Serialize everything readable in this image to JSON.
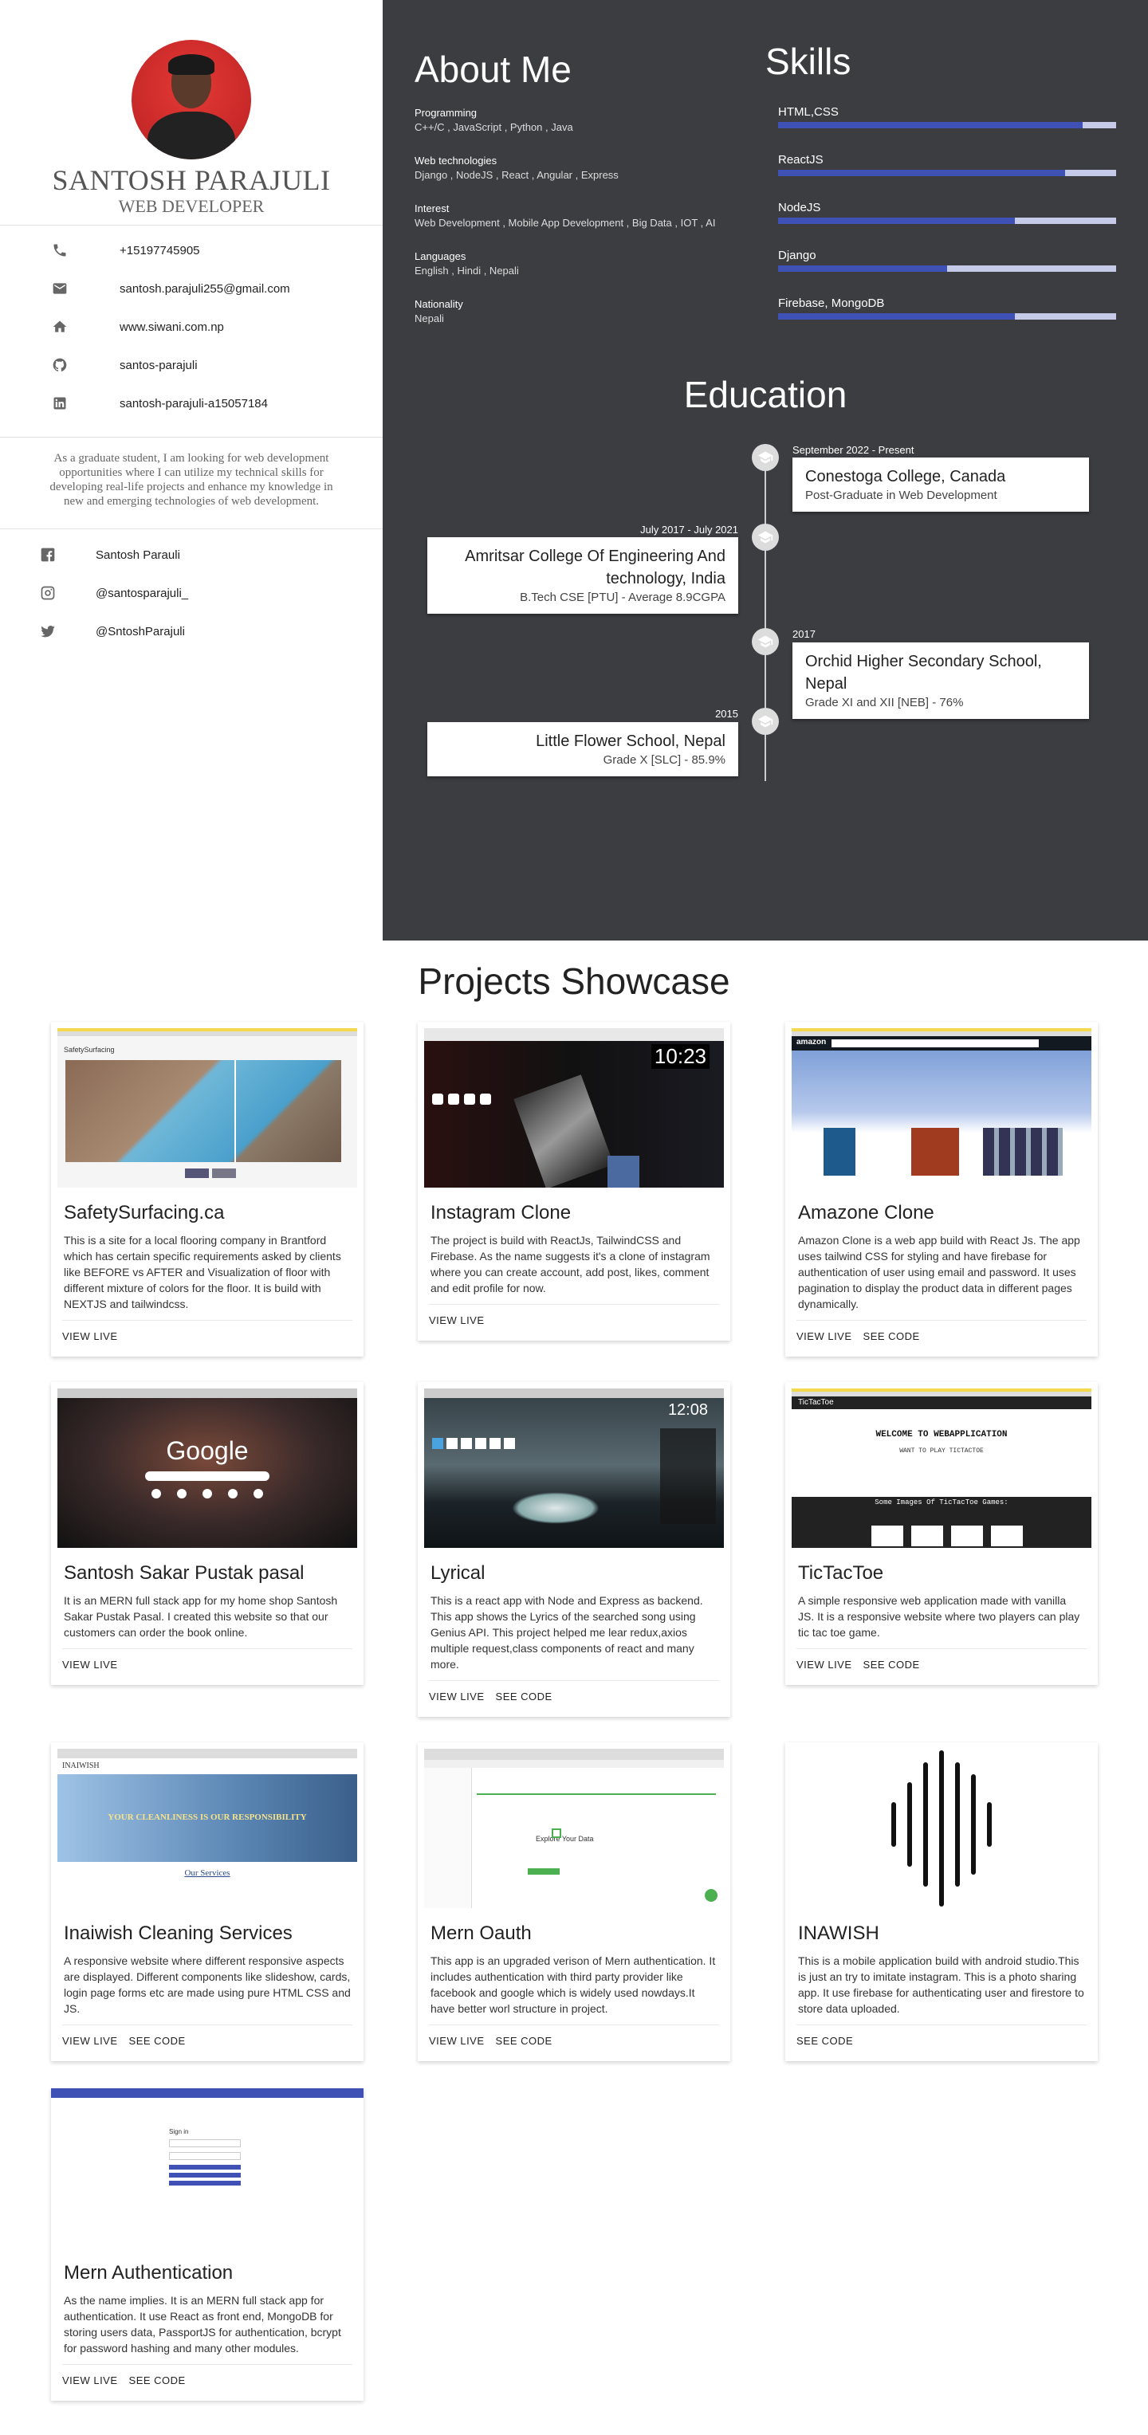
{
  "profile": {
    "name": "SANTOSH PARAJULI",
    "role": "WEB DEVELOPER",
    "contacts": [
      {
        "icon": "phone-icon",
        "text": "+15197745905"
      },
      {
        "icon": "email-icon",
        "text": "santosh.parajuli255@gmail.com"
      },
      {
        "icon": "home-icon",
        "text": "www.siwani.com.np"
      },
      {
        "icon": "github-icon",
        "text": "santos-parajuli"
      },
      {
        "icon": "linkedin-icon",
        "text": "santosh-parajuli-a15057184"
      }
    ],
    "summary": "As a graduate student, I am looking for web development opportunities where I can utilize my technical skills for developing real-life projects and enhance my knowledge in new and emerging technologies of web development.",
    "social": [
      {
        "icon": "facebook-icon",
        "text": "Santosh Parauli"
      },
      {
        "icon": "instagram-icon",
        "text": "@santosparajuli_"
      },
      {
        "icon": "twitter-icon",
        "text": "@SntoshParajuli"
      }
    ]
  },
  "about": {
    "title": "About Me",
    "items": [
      {
        "key": "Programming",
        "value": "C++/C , JavaScript , Python , Java"
      },
      {
        "key": "Web technologies",
        "value": "Django , NodeJS , React , Angular , Express"
      },
      {
        "key": "Interest",
        "value": "Web Development , Mobile App Development , Big Data , IOT , AI"
      },
      {
        "key": "Languages",
        "value": "English , Hindi , Nepali"
      },
      {
        "key": "Nationality",
        "value": "Nepali"
      }
    ]
  },
  "skills": {
    "title": "Skills",
    "items": [
      {
        "name": "HTML,CSS",
        "level": 0.9
      },
      {
        "name": "ReactJS",
        "level": 0.85
      },
      {
        "name": "NodeJS",
        "level": 0.7
      },
      {
        "name": "Django",
        "level": 0.5
      },
      {
        "name": "Firebase, MongoDB",
        "level": 0.7
      }
    ]
  },
  "education": {
    "title": "Education",
    "items": [
      {
        "date": "September 2022 - Present",
        "school": "Conestoga College, Canada",
        "detail": "Post-Graduate in Web Development"
      },
      {
        "date": "July 2017 - July 2021",
        "school": "Amritsar College Of Engineering And technology, India",
        "detail": "B.Tech CSE [PTU] - Average 8.9CGPA"
      },
      {
        "date": "2017",
        "school": "Orchid Higher Secondary School, Nepal",
        "detail": "Grade XI and XII [NEB] - 76%"
      },
      {
        "date": "2015",
        "school": "Little Flower School, Nepal",
        "detail": "Grade X [SLC] - 85.9%"
      }
    ]
  },
  "projects": {
    "title": "Projects Showcase",
    "items": [
      {
        "title": "SafetySurfacing.ca",
        "desc": "This is a site for a local flooring company in Brantford which has certain specific requirements asked by clients like BEFORE vs AFTER and Visualization of floor with different mixture of colors for the floor. It is build with NEXTJS and tailwindcss.",
        "view": "VIEW LIVE",
        "code": ""
      },
      {
        "title": "Instagram Clone",
        "desc": "The project is build with ReactJs, TailwindCSS and Firebase. As the name suggests it's a clone of instagram where you can create account, add post, likes, comment and edit profile for now.",
        "view": "VIEW LIVE",
        "code": ""
      },
      {
        "title": "Amazone Clone",
        "desc": "Amazon Clone is a web app build with React Js. The app uses tailwind CSS for styling and have firebase for authentication of user using email and password. It uses pagination to display the product data in different pages dynamically.",
        "view": "VIEW LIVE",
        "code": "SEE CODE"
      },
      {
        "title": "Santosh Sakar Pustak pasal",
        "desc": "It is an MERN full stack app for my home shop Santosh Sakar Pustak Pasal. I created this website so that our customers can order the book online.",
        "view": "VIEW LIVE",
        "code": ""
      },
      {
        "title": "Lyrical",
        "desc": "This is a react app with Node and Express as backend. This app shows the Lyrics of the searched song using Genius API. This project helped me lear redux,axios multiple request,class components of react and many more.",
        "view": "VIEW LIVE",
        "code": "SEE CODE"
      },
      {
        "title": "TicTacToe",
        "desc": "A simple responsive web application made with vanilla JS. It is a responsive website where two players can play tic tac toe game.",
        "view": "VIEW LIVE",
        "code": "SEE CODE"
      },
      {
        "title": "Inaiwish Cleaning Services",
        "desc": "A responsive website where different responsive aspects are displayed. Different components like slideshow, cards, login page forms etc are made using pure HTML CSS and JS.",
        "view": "VIEW LIVE",
        "code": "SEE CODE"
      },
      {
        "title": "Mern Oauth",
        "desc": "This app is an upgraded verison of Mern authentication. It includes authentication with third party provider like facebook and google which is widely used nowdays.It have better worl structure in project.",
        "view": "VIEW LIVE",
        "code": "SEE CODE"
      },
      {
        "title": "INAWISH",
        "desc": "This is a mobile application build with android studio.This is just an try to imitate instagram. This is a photo sharing app. It use firebase for authenticating user and firestore to store data uploaded.",
        "view": "",
        "code": "SEE CODE"
      },
      {
        "title": "Mern Authentication",
        "desc": "As the name implies. It is an MERN full stack app for authentication. It use React as front end, MongoDB for storing users data, PassportJS for authentication, bcrypt for password hashing and many other modules.",
        "view": "VIEW LIVE",
        "code": "SEE CODE"
      }
    ],
    "shot_text": {
      "safety_logo": "SafetySurfacing",
      "amazon_logo": "amazon",
      "google_logo": "Google",
      "lyrical_time": "12:08",
      "insta_time": "10:23",
      "tic_header": "TicTacToe",
      "tic_welcome": "WELCOME TO WEBAPPLICATION",
      "tic_want": "WANT TO PLAY TICTACTOE",
      "tic_some": "Some Images Of TicTacToe Games:",
      "inaiwish_logo": "INAIWISH",
      "inaiwish_banner": "YOUR CLEANLINESS IS OUR RESPONSIBILITY",
      "inaiwish_services": "Our Services",
      "oauth_heading": "Explore Your Data",
      "mern_auth_signin": "Sign in"
    }
  },
  "colors": {
    "dark_panel": "#3c3d41",
    "skill_fill": "#3f51b5",
    "skill_track": "#c5cae9"
  }
}
